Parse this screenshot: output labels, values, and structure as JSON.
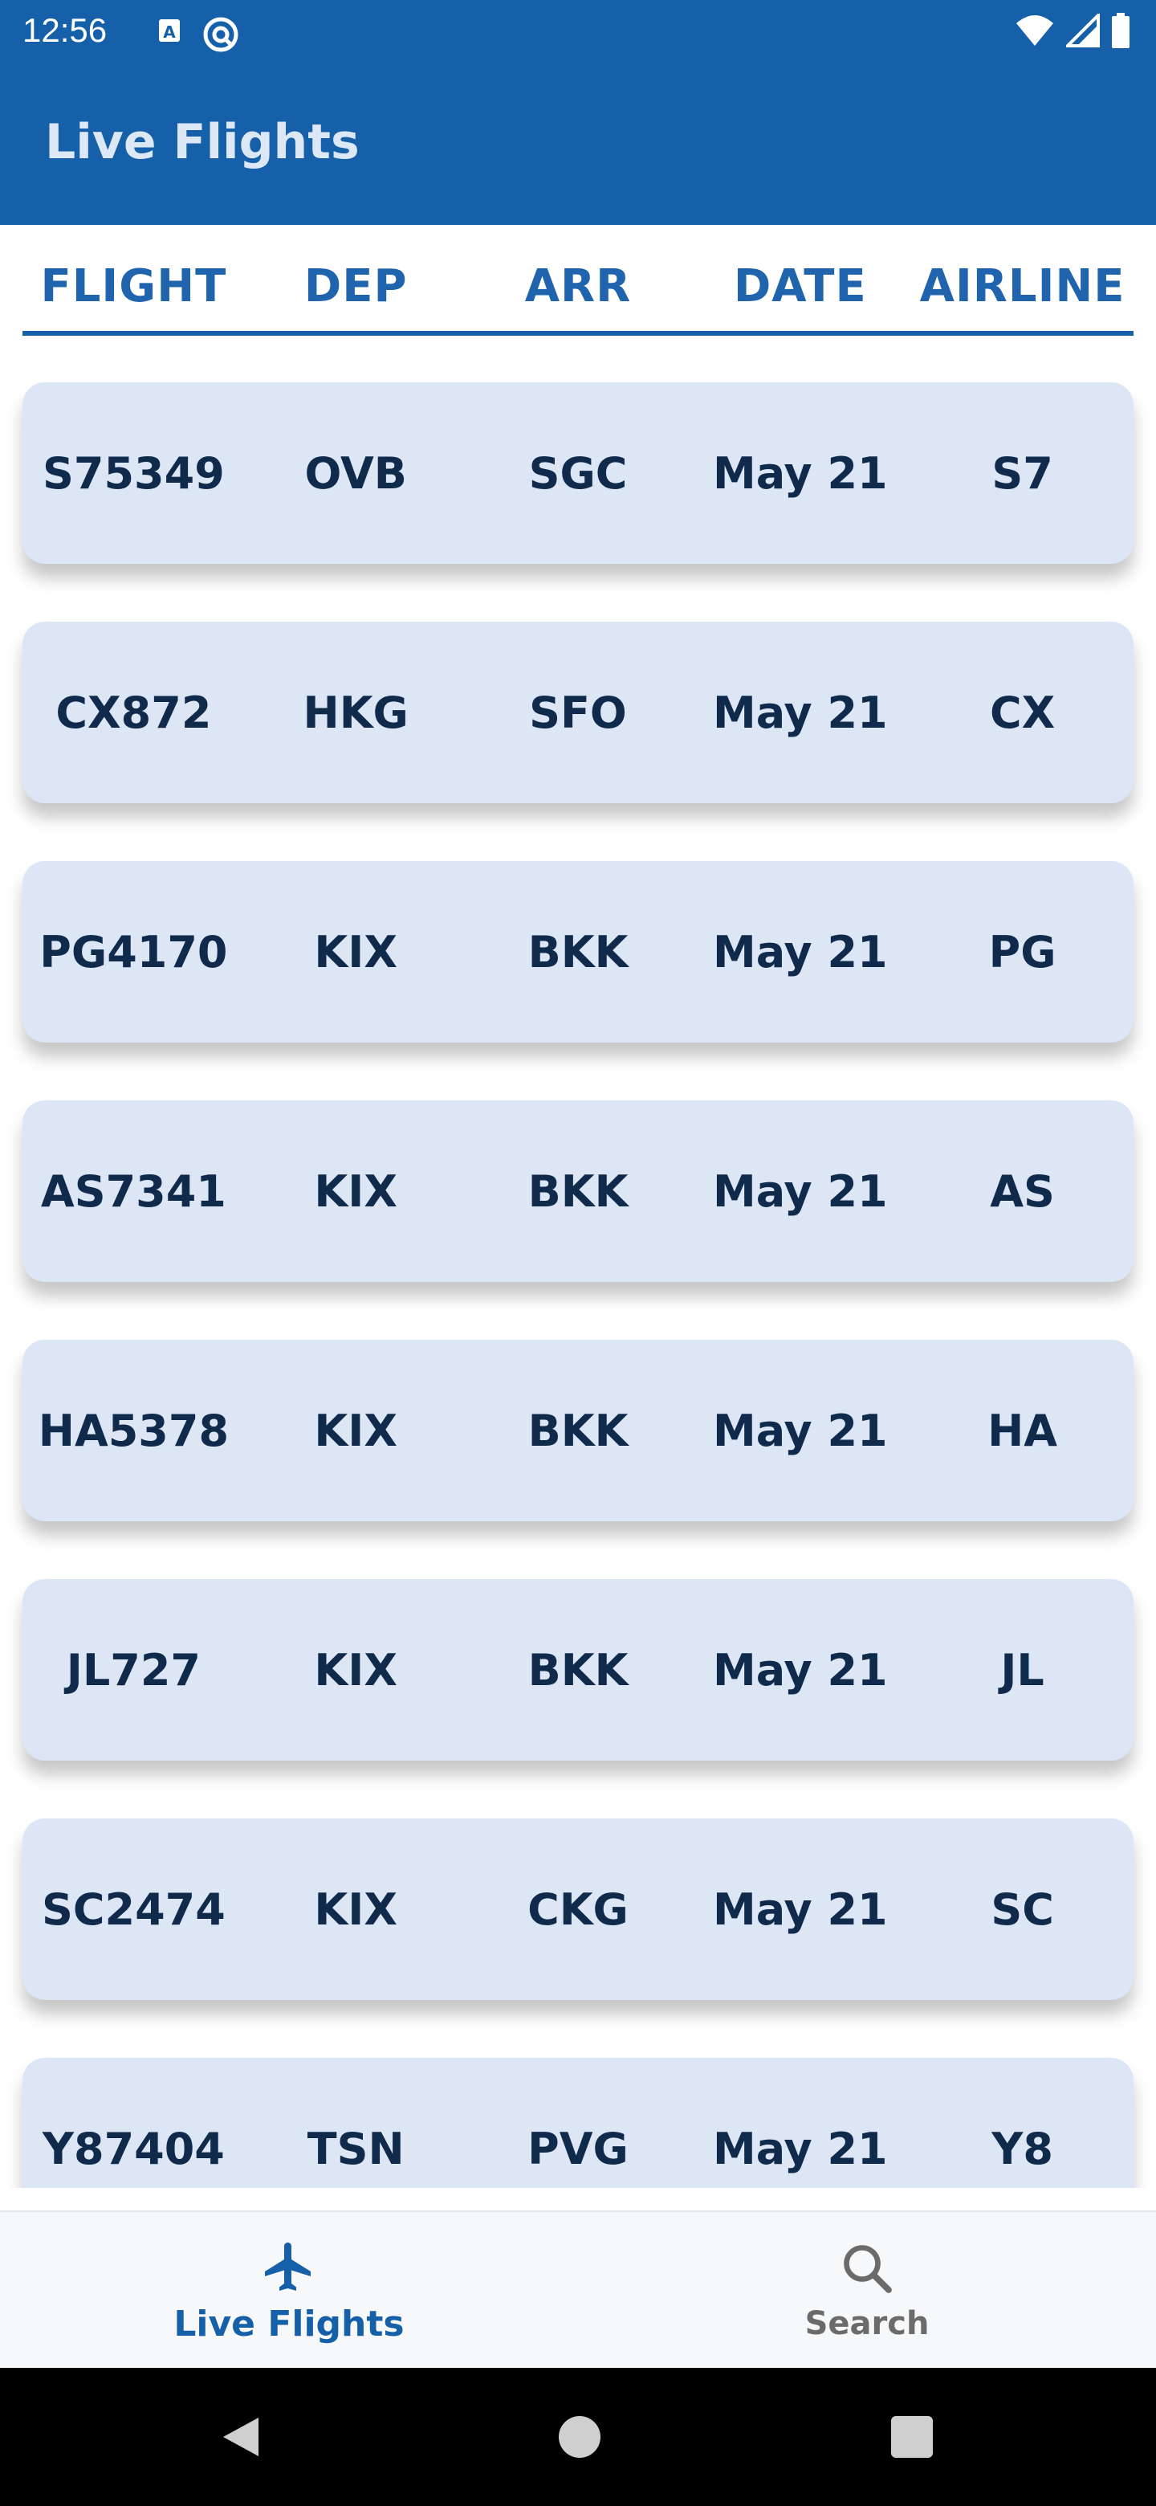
{
  "status_bar": {
    "time": "12:56",
    "left_icons": [
      "a-badge-icon",
      "at-sign-icon"
    ],
    "right_icons": [
      "wifi-icon",
      "signal-icon",
      "battery-icon"
    ]
  },
  "app_bar": {
    "title": "Live Flights"
  },
  "columns": [
    "FLIGHT",
    "DEP",
    "ARR",
    "DATE",
    "AIRLINE"
  ],
  "flights": [
    {
      "flight": "S75349",
      "dep": "OVB",
      "arr": "SGC",
      "date": "May 21",
      "airline": "S7"
    },
    {
      "flight": "CX872",
      "dep": "HKG",
      "arr": "SFO",
      "date": "May 21",
      "airline": "CX"
    },
    {
      "flight": "PG4170",
      "dep": "KIX",
      "arr": "BKK",
      "date": "May 21",
      "airline": "PG"
    },
    {
      "flight": "AS7341",
      "dep": "KIX",
      "arr": "BKK",
      "date": "May 21",
      "airline": "AS"
    },
    {
      "flight": "HA5378",
      "dep": "KIX",
      "arr": "BKK",
      "date": "May 21",
      "airline": "HA"
    },
    {
      "flight": "JL727",
      "dep": "KIX",
      "arr": "BKK",
      "date": "May 21",
      "airline": "JL"
    },
    {
      "flight": "SC2474",
      "dep": "KIX",
      "arr": "CKG",
      "date": "May 21",
      "airline": "SC"
    },
    {
      "flight": "Y87404",
      "dep": "TSN",
      "arr": "PVG",
      "date": "May 21",
      "airline": "Y8"
    }
  ],
  "bottom_nav": {
    "items": [
      {
        "label": "Live Flights",
        "icon": "airplane-icon",
        "active": true
      },
      {
        "label": "Search",
        "icon": "search-icon",
        "active": false
      }
    ]
  },
  "colors": {
    "primary": "#1560a8",
    "card_bg": "#dde6f5",
    "card_text": "#102a4c"
  }
}
